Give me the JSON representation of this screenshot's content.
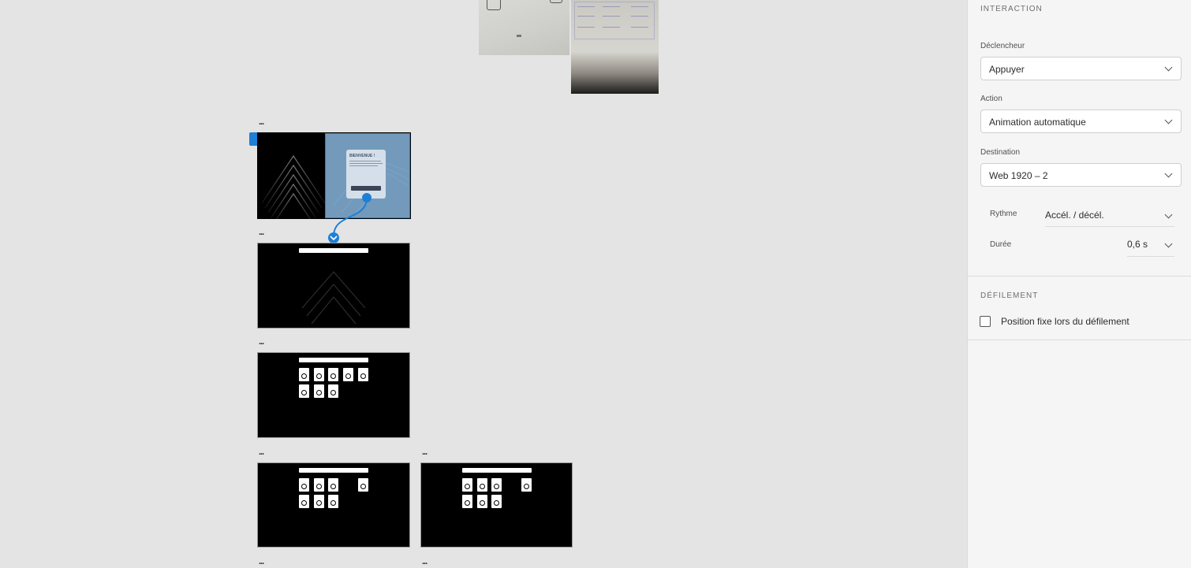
{
  "canvas": {
    "artboard_menu_glyph": "...",
    "welcome_title": "BIENVENUE !"
  },
  "panel": {
    "interaction": {
      "title": "INTERACTION",
      "trigger": {
        "label": "Déclencheur",
        "value": "Appuyer"
      },
      "action": {
        "label": "Action",
        "value": "Animation automatique"
      },
      "destination": {
        "label": "Destination",
        "value": "Web 1920 – 2"
      },
      "rhythm": {
        "label": "Rythme",
        "value": "Accél. / décél."
      },
      "duration": {
        "label": "Durée",
        "value": "0,6 s"
      }
    },
    "scrolling": {
      "title": "DÉFILEMENT",
      "fixed_position": {
        "label": "Position fixe lors du défilement",
        "checked": false
      }
    }
  },
  "colors": {
    "selection": "#1e7fd6",
    "canvas_bg": "#e4e4e4",
    "panel_bg": "#f5f5f5"
  },
  "icons": [
    "chevron-down-icon",
    "connection-arrow-icon",
    "selection-handle-icon"
  ]
}
